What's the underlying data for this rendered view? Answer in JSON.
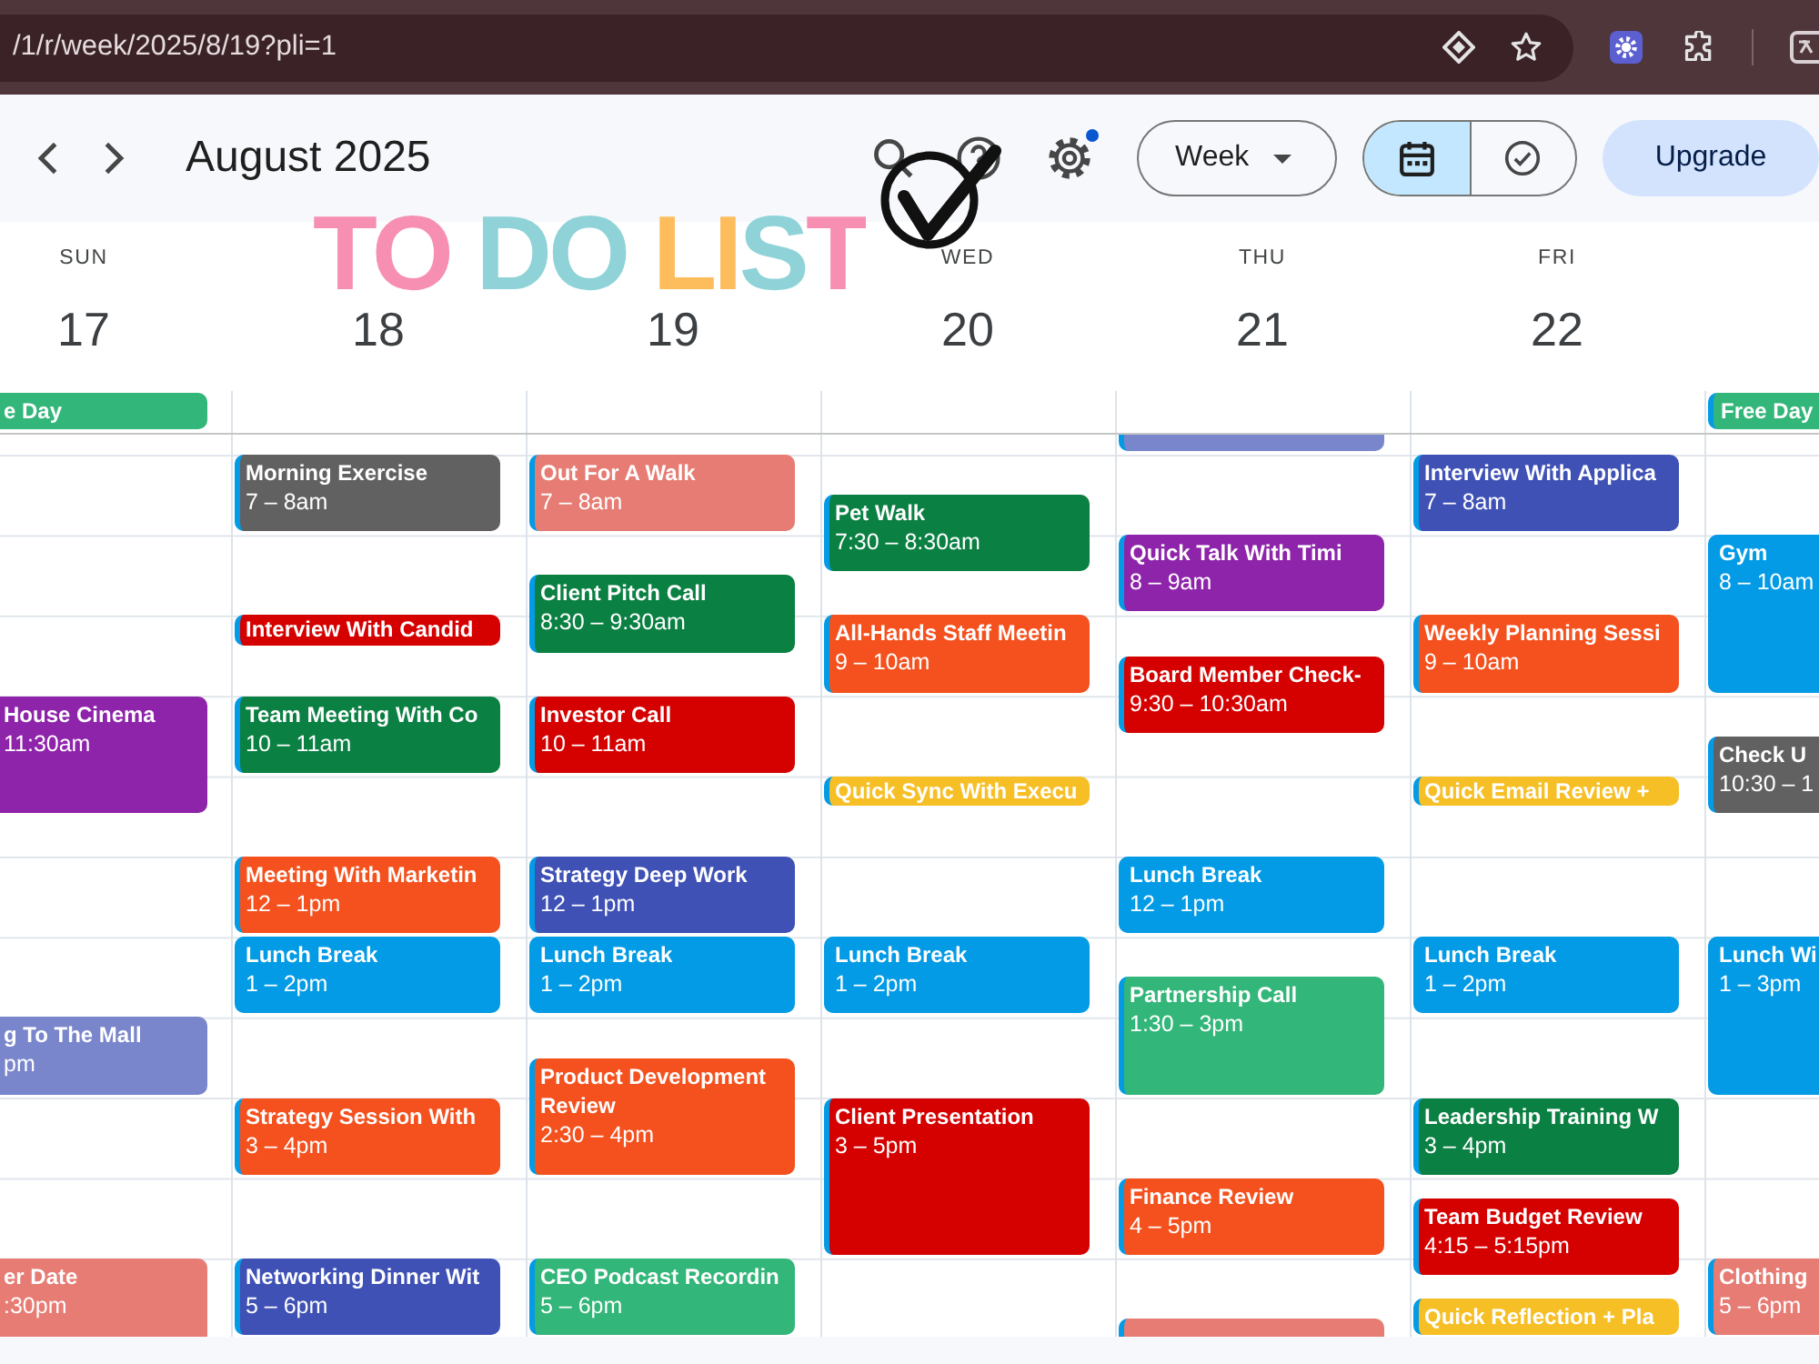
{
  "browser": {
    "url": "/1/r/week/2025/8/19?pli=1"
  },
  "toolbar": {
    "title": "August 2025",
    "settings_badge": true,
    "view": "Week",
    "modes": [
      {
        "kind": "calendar",
        "selected": true
      },
      {
        "kind": "tasks",
        "selected": false
      }
    ],
    "upgrade": "Upgrade"
  },
  "overlay": {
    "words": [
      "TO",
      "DO",
      "LIST"
    ]
  },
  "days": [
    {
      "name": "SUN",
      "date": "17",
      "all_day": [
        {
          "title": "e Day",
          "color": "#33b679"
        }
      ],
      "events": [
        {
          "title": "House Cinema",
          "time": "11:30am",
          "color": "#8e24aa"
        },
        {
          "title": "g To The Mall",
          "time": "pm",
          "color": "#7986cb"
        },
        {
          "title": "er Date",
          "time": ":30pm",
          "color": "#e67c73"
        }
      ]
    },
    {
      "date": "18",
      "events": [
        {
          "title": "Morning Exercise",
          "time": "7 – 8am",
          "color": "#616161"
        },
        {
          "title": "Interview With Candid",
          "color": "#d50000"
        },
        {
          "title": "Team Meeting With Co",
          "time": "10 – 11am",
          "color": "#0b8043"
        },
        {
          "title": "Meeting With Marketin",
          "time": "12 – 1pm",
          "color": "#f4511e"
        },
        {
          "title": "Lunch Break",
          "time": "1 – 2pm",
          "color": "#039be5"
        },
        {
          "title": "Strategy Session With",
          "time": "3 – 4pm",
          "color": "#f4511e"
        },
        {
          "title": "Networking Dinner Wit",
          "time": "5 – 6pm",
          "color": "#3f51b5"
        }
      ]
    },
    {
      "date": "19",
      "events": [
        {
          "title": "Out For A Walk",
          "time": "7 – 8am",
          "color": "#e67c73"
        },
        {
          "title": "Client Pitch Call",
          "time": "8:30 – 9:30am",
          "color": "#0b8043"
        },
        {
          "title": "Investor Call",
          "time": "10 – 11am",
          "color": "#d50000"
        },
        {
          "title": "Strategy Deep Work",
          "time": "12 – 1pm",
          "color": "#3f51b5"
        },
        {
          "title": "Lunch Break",
          "time": "1 – 2pm",
          "color": "#039be5"
        },
        {
          "title": "Product Development Review",
          "time": "2:30 – 4pm",
          "color": "#f4511e"
        },
        {
          "title": "CEO Podcast Recordin",
          "time": "5 – 6pm",
          "color": "#33b679"
        }
      ]
    },
    {
      "name": "WED",
      "date": "20",
      "events": [
        {
          "title": "Pet Walk",
          "time": "7:30 – 8:30am",
          "color": "#0b8043"
        },
        {
          "title": "All-Hands Staff Meetin",
          "time": "9 – 10am",
          "color": "#f4511e"
        },
        {
          "title": "Quick Sync With Execu",
          "color": "#f6bf26"
        },
        {
          "title": "Lunch Break",
          "time": "1 – 2pm",
          "color": "#039be5"
        },
        {
          "title": "Client Presentation",
          "time": "3 – 5pm",
          "color": "#d50000"
        }
      ]
    },
    {
      "name": "THU",
      "date": "21",
      "events": [
        {
          "color": "#7986cb"
        },
        {
          "title": "Quick Talk With Timi",
          "time": "8 – 9am",
          "color": "#8e24aa"
        },
        {
          "title": "Board Member Check-",
          "time": "9:30 – 10:30am",
          "color": "#d50000"
        },
        {
          "title": "Lunch Break",
          "time": "12 – 1pm",
          "color": "#039be5"
        },
        {
          "title": "Partnership Call",
          "time": "1:30 – 3pm",
          "color": "#33b679"
        },
        {
          "title": "Finance Review",
          "time": "4 – 5pm",
          "color": "#f4511e"
        },
        {
          "color": "#e67c73"
        }
      ]
    },
    {
      "name": "FRI",
      "date": "22",
      "events": [
        {
          "title": "Interview With Applica",
          "time": "7 – 8am",
          "color": "#3f51b5"
        },
        {
          "title": "Weekly Planning Sessi",
          "time": "9 – 10am",
          "color": "#f4511e"
        },
        {
          "title": "Quick Email Review +",
          "color": "#f6bf26"
        },
        {
          "title": "Lunch Break",
          "time": "1 – 2pm",
          "color": "#039be5"
        },
        {
          "title": "Leadership Training W",
          "time": "3 – 4pm",
          "color": "#0b8043"
        },
        {
          "title": "Team Budget Review",
          "time": "4:15 – 5:15pm",
          "color": "#d50000"
        },
        {
          "title": "Quick Reflection + Pla",
          "color": "#f6bf26"
        }
      ]
    },
    {
      "all_day": [
        {
          "title": "Free Day",
          "color": "#33b679"
        }
      ],
      "events": [
        {
          "title": "Gym",
          "time": "8 – 10am",
          "color": "#039be5"
        },
        {
          "title": "Check U",
          "time": "10:30 – 1",
          "color": "#616161"
        },
        {
          "title": "Lunch Wi",
          "time": "1 – 3pm",
          "color": "#039be5"
        },
        {
          "title": "Clothing",
          "time": "5 – 6pm",
          "color": "#e67c73"
        }
      ]
    }
  ]
}
